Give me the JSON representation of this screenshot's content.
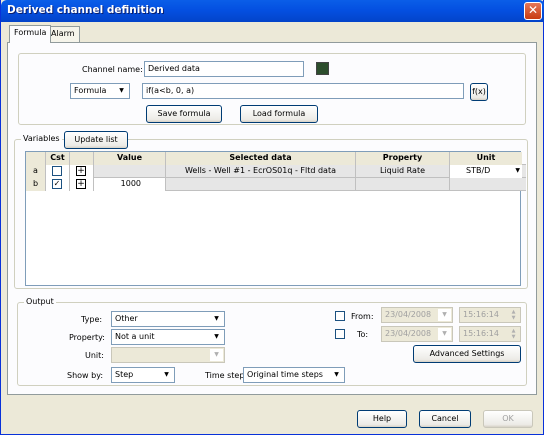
{
  "window": {
    "title": "Derived channel definition",
    "close": "✕"
  },
  "tabs": [
    {
      "label": "Formula"
    },
    {
      "label": "Alarm"
    }
  ],
  "formula": {
    "channel_name_label": "Channel name:",
    "channel_name_value": "Derived data",
    "mode_value": "Formula",
    "formula_value": "if(a<b, 0, a)",
    "fx_label": "f(x)",
    "save_label": "Save formula",
    "load_label": "Load formula"
  },
  "variables": {
    "group_label": "Variables",
    "update_label": "Update list",
    "columns": [
      "Cst",
      "Value",
      "Selected data",
      "Property",
      "Unit"
    ],
    "rows": [
      {
        "name": "a",
        "cst": false,
        "value": "",
        "selected": "Wells - Well #1 - EcrOS01q - Fltd data",
        "property": "Liquid Rate",
        "unit": "STB/D"
      },
      {
        "name": "b",
        "cst": true,
        "value": "1000",
        "selected": "",
        "property": "",
        "unit": ""
      }
    ]
  },
  "output": {
    "group_label": "Output",
    "type_label": "Type:",
    "type_value": "Other",
    "property_label": "Property:",
    "property_value": "Not a unit",
    "unit_label": "Unit:",
    "unit_value": "",
    "showby_label": "Show by:",
    "showby_value": "Step",
    "timestep_label": "Time step:",
    "timestep_value": "Original time steps",
    "from_label": "From:",
    "from_date": "23/04/2008",
    "from_time": "15:16:14",
    "to_label": "To:",
    "to_date": "23/04/2008",
    "to_time": "15:16:14",
    "advanced_label": "Advanced Settings"
  },
  "footer": {
    "help": "Help",
    "cancel": "Cancel",
    "ok": "OK"
  }
}
